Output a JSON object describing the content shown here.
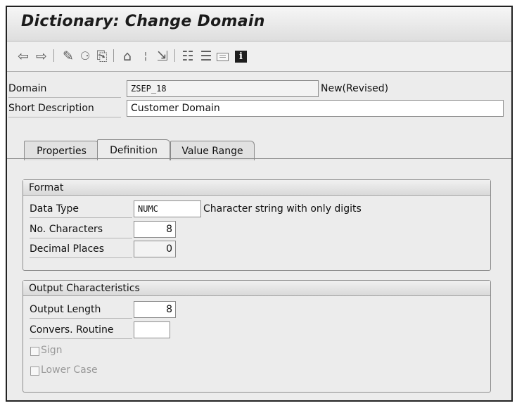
{
  "window": {
    "title": "Dictionary: Change Domain"
  },
  "toolbar": {
    "icons": [
      "back-arrow-icon",
      "forward-arrow-icon",
      "display-change-icon",
      "check-icon",
      "activate-icon",
      "where-used-icon",
      "info-separator-icon",
      "navigate-icon",
      "hierarchy-icon",
      "table-icon",
      "monitor-icon",
      "info-icon"
    ]
  },
  "header": {
    "domain_label": "Domain",
    "domain_value": "ZSEP_18",
    "status": "New(Revised)",
    "short_desc_label": "Short Description",
    "short_desc_value": "Customer Domain"
  },
  "tabs": [
    {
      "label": "Properties"
    },
    {
      "label": "Definition"
    },
    {
      "label": "Value Range"
    }
  ],
  "format": {
    "title": "Format",
    "data_type_label": "Data Type",
    "data_type_value": "NUMC",
    "data_type_desc": "Character string with only digits",
    "no_chars_label": "No. Characters",
    "no_chars_value": "8",
    "decimal_label": "Decimal Places",
    "decimal_value": "0"
  },
  "output": {
    "title": "Output Characteristics",
    "length_label": "Output Length",
    "length_value": "8",
    "routine_label": "Convers. Routine",
    "routine_value": "",
    "sign_label": "Sign",
    "lower_label": "Lower Case"
  }
}
